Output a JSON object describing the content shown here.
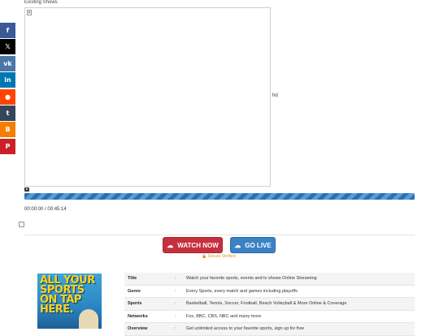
{
  "share": {
    "items": [
      {
        "name": "facebook",
        "glyph": "f",
        "color": "#3b5998"
      },
      {
        "name": "x",
        "glyph": "𝕏",
        "color": "#000000"
      },
      {
        "name": "vk",
        "glyph": "vk",
        "color": "#4a76a8"
      },
      {
        "name": "linkedin",
        "glyph": "in",
        "color": "#0077b5"
      },
      {
        "name": "reddit",
        "glyph": "●",
        "color": "#ff4500"
      },
      {
        "name": "tumblr",
        "glyph": "t",
        "color": "#35465c"
      },
      {
        "name": "blogger",
        "glyph": "B",
        "color": "#f57d00"
      },
      {
        "name": "pinterest",
        "glyph": "P",
        "color": "#cb2027"
      }
    ]
  },
  "player": {
    "title": "Exciting Shows",
    "quality": "hd",
    "time": "00:00:00 / 00:45:14"
  },
  "actions": {
    "watch_label": "WATCH NOW",
    "live_label": "GO LIVE",
    "secure_label": "🔒 Secure Verified",
    "watch_color": "#c6303e",
    "live_color": "#3b82c4"
  },
  "poster": {
    "text": "ALL YOUR SPORTS ON TAP HERE."
  },
  "details": {
    "rows": [
      {
        "label": "Title",
        "sep": ":",
        "value": "Watch your favorite sports, events and tv shows Online Streaming"
      },
      {
        "label": "Genre",
        "sep": ":",
        "value": "Every Sports, every match and games including playoffs"
      },
      {
        "label": "Sports",
        "sep": ":",
        "value": "Basketball, Tennis, Soccer, Football, Beach Volleyball & More Online & Coverage"
      },
      {
        "label": "Networks",
        "sep": ":",
        "value": "Fox, BBC, CBS, NBC and many more"
      },
      {
        "label": "Overview",
        "sep": ":",
        "value": "Get unlimited access to your favorite sports, sign up for free"
      }
    ]
  }
}
